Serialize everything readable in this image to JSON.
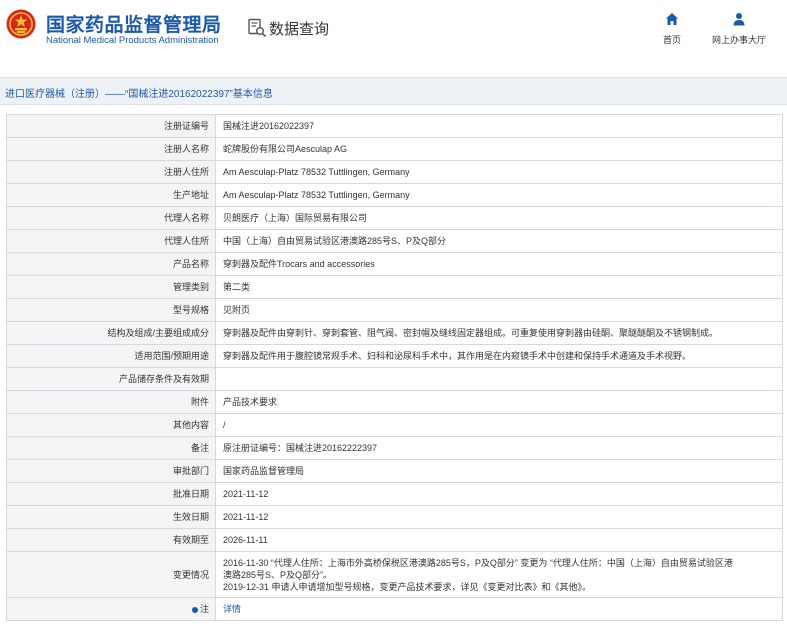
{
  "header": {
    "agency_cn": "国家药品监督管理局",
    "agency_en": "National Medical Products Administration",
    "db_title": "数据查询",
    "nav": [
      {
        "label": "首页",
        "icon": "home-icon"
      },
      {
        "label": "网上办事大厅",
        "icon": "user-icon"
      }
    ]
  },
  "breadcrumb": "进口医疗器械（注册）——“国械注进20162022397”基本信息",
  "rows": [
    {
      "label": "注册证编号",
      "value": "国械注进20162022397"
    },
    {
      "label": "注册人名称",
      "value": "蛇牌股份有限公司Aesculap AG"
    },
    {
      "label": "注册人住所",
      "value": "Am Aesculap-Platz 78532 Tuttlingen, Germany"
    },
    {
      "label": "生产地址",
      "value": "Am Aesculap-Platz 78532 Tuttlingen, Germany"
    },
    {
      "label": "代理人名称",
      "value": "贝朗医疗（上海）国际贸易有限公司"
    },
    {
      "label": "代理人住所",
      "value": "中国（上海）自由贸易试验区港澳路285号S、P及Q部分"
    },
    {
      "label": "产品名称",
      "value": "穿刺器及配件Trocars and accessories"
    },
    {
      "label": "管理类别",
      "value": "第二类"
    },
    {
      "label": "型号规格",
      "value": "见附页"
    },
    {
      "label": "结构及组成/主要组成成分",
      "value": "穿刺器及配件由穿刺针、穿刺套管、阻气阀、密封帽及缝线固定器组成。可重复使用穿刺器由硅酮、聚醚醚酮及不锈钢制成。"
    },
    {
      "label": "适用范围/预期用途",
      "value": "穿刺器及配件用于腹腔镜常规手术、妇科和泌尿科手术中，其作用是在内窥镜手术中创建和保持手术通道及手术视野。"
    },
    {
      "label": "产品储存条件及有效期",
      "value": ""
    },
    {
      "label": "附件",
      "value": "产品技术要求"
    },
    {
      "label": "其他内容",
      "value": "/"
    },
    {
      "label": "备注",
      "value": "原注册证编号：国械注进20162222397"
    },
    {
      "label": "审批部门",
      "value": "国家药品监督管理局"
    },
    {
      "label": "批准日期",
      "value": "2021-11-12"
    },
    {
      "label": "生效日期",
      "value": "2021-11-12"
    },
    {
      "label": "有效期至",
      "value": "2026-11-11"
    }
  ],
  "change_row": {
    "label": "变更情况",
    "lines": [
      "2016-11-30 “代理人住所：上海市外高桥保税区港澳路285号S，P及Q部分” 变更为 “代理人住所：中国（上海）自由贸易试验区港",
      "澳路285号S、P及Q部分”。",
      "2019-12-31 申请人申请增加型号规格，变更产品技术要求，详见《变更对比表》和《其他》。"
    ]
  },
  "note_row": {
    "label": "注",
    "link": "详情"
  }
}
